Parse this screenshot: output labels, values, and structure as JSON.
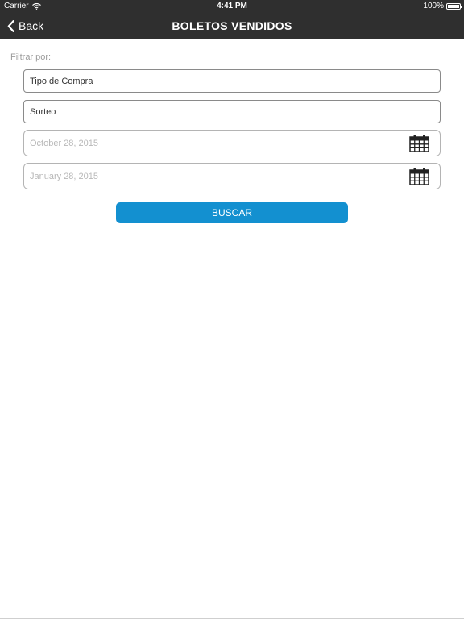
{
  "status_bar": {
    "carrier": "Carrier",
    "time": "4:41 PM",
    "battery": "100%"
  },
  "nav": {
    "back_label": "Back",
    "title": "BOLETOS VENDIDOS"
  },
  "filter": {
    "label": "Filtrar por:",
    "tipo_compra": "Tipo de Compra",
    "sorteo": "Sorteo",
    "fecha_inicio": "October 28, 2015",
    "fecha_fin": "January 28, 2015"
  },
  "search_button": "BUSCAR",
  "colors": {
    "nav_bg": "#2f2f2f",
    "button_bg": "#1390d0",
    "placeholder": "#b8b8b8"
  },
  "icons": [
    "wifi-icon",
    "battery-icon",
    "chevron-left-icon",
    "calendar-icon"
  ]
}
